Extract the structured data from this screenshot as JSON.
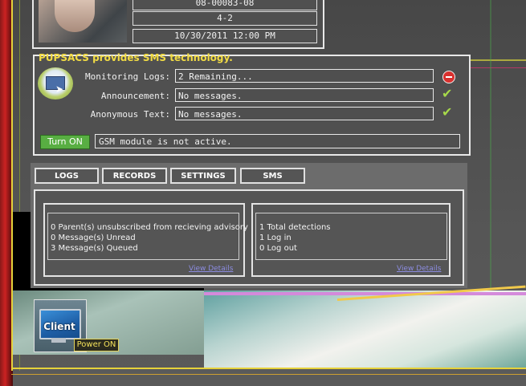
{
  "profile": {
    "id": "08-00083-08",
    "section": "4-2",
    "datetime": "10/30/2011 12:00 PM"
  },
  "sms": {
    "title": "PUPSACS provides SMS technology.",
    "rows": [
      {
        "label": "Monitoring Logs:",
        "value": "2 Remaining...",
        "status": "error"
      },
      {
        "label": "Announcement:",
        "value": "No messages.",
        "status": "ok"
      },
      {
        "label": "Anonymous Text:",
        "value": "No messages.",
        "status": "ok"
      }
    ],
    "turn_on_label": "Turn ON",
    "gsm_status": "GSM module is not active."
  },
  "tabs": [
    "LOGS",
    "RECORDS",
    "SETTINGS",
    "SMS"
  ],
  "cards": {
    "left": {
      "lines": [
        "0 Parent(s) unsubscribed from recieving advisory",
        "0 Message(s) Unread",
        "3 Message(s) Queued"
      ],
      "link": "View Details"
    },
    "right": {
      "lines": [
        "1 Total detections",
        "1 Log in",
        "0 Log out"
      ],
      "link": "View Details"
    }
  },
  "client": {
    "label": "Client",
    "tooltip": "Power ON"
  },
  "colors": {
    "title_yellow": "#f2dc44",
    "turn_on_green": "#58ae42",
    "link_blue": "#8c8ce0",
    "error_red": "#d9302e",
    "ok_green": "#a7d94a"
  }
}
